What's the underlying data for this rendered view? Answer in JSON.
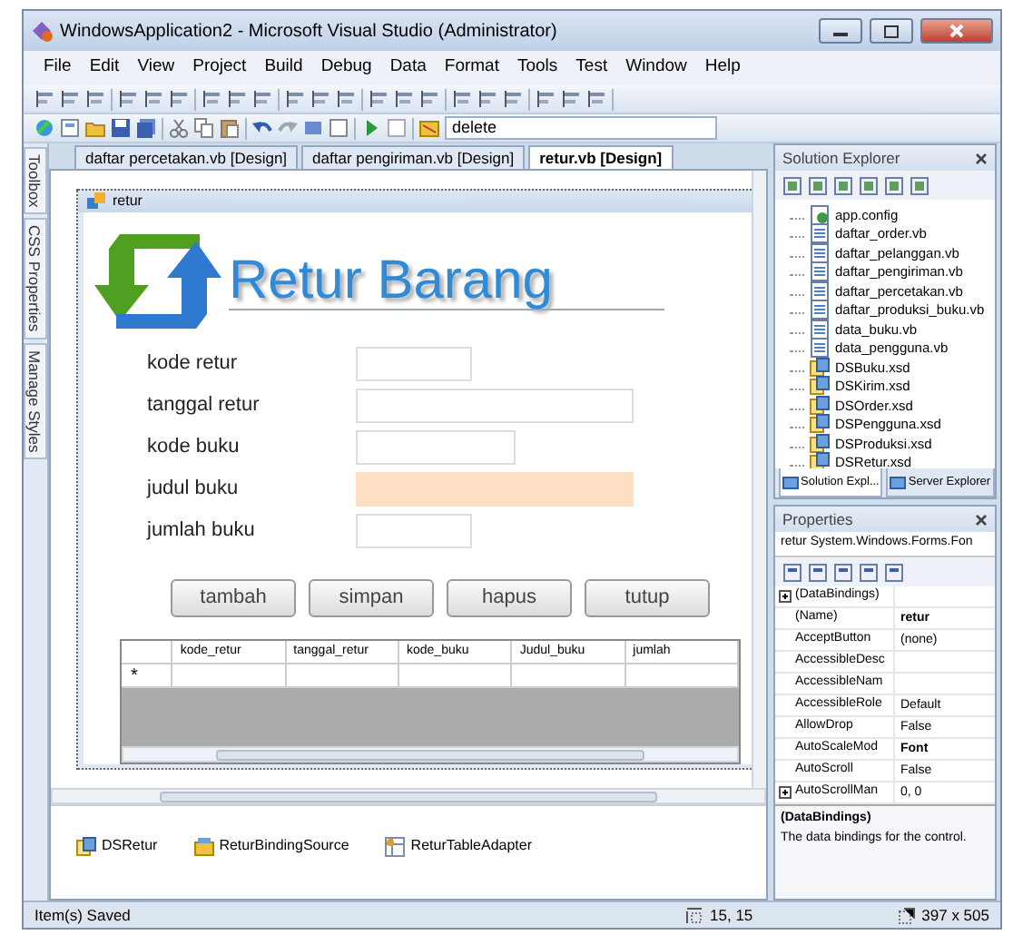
{
  "window": {
    "title": "WindowsApplication2 - Microsoft Visual Studio (Administrator)"
  },
  "menu": [
    "File",
    "Edit",
    "View",
    "Project",
    "Build",
    "Debug",
    "Data",
    "Format",
    "Tools",
    "Test",
    "Window",
    "Help"
  ],
  "toolbar": {
    "find_value": "delete"
  },
  "side_tabs": [
    "Toolbox",
    "CSS Properties",
    "Manage Styles"
  ],
  "doc_tabs": [
    {
      "label": "daftar percetakan.vb [Design]",
      "selected": false
    },
    {
      "label": "daftar pengiriman.vb [Design]",
      "selected": false
    },
    {
      "label": "retur.vb [Design]",
      "selected": true
    }
  ],
  "form": {
    "title": "retur",
    "heading": "Retur Barang",
    "fields": [
      {
        "label": "kode retur",
        "highlighted": false
      },
      {
        "label": "tanggal retur",
        "highlighted": false
      },
      {
        "label": "kode buku",
        "highlighted": false
      },
      {
        "label": "judul buku",
        "highlighted": true
      },
      {
        "label": "jumlah buku",
        "highlighted": false
      }
    ],
    "buttons": [
      "tambah",
      "simpan",
      "hapus",
      "tutup"
    ],
    "grid": {
      "columns": [
        "kode_retur",
        "tanggal_retur",
        "kode_buku",
        "Judul_buku",
        "jumlah"
      ],
      "new_row_marker": "*"
    }
  },
  "tray": [
    {
      "label": "DSRetur",
      "kind": "dataset"
    },
    {
      "label": "ReturBindingSource",
      "kind": "binding"
    },
    {
      "label": "ReturTableAdapter",
      "kind": "adapter"
    }
  ],
  "solution_explorer": {
    "title": "Solution Explorer",
    "items": [
      {
        "label": "app.config",
        "kind": "config"
      },
      {
        "label": "daftar_order.vb",
        "kind": "form"
      },
      {
        "label": "daftar_pelanggan.vb",
        "kind": "form"
      },
      {
        "label": "daftar_pengiriman.vb",
        "kind": "form"
      },
      {
        "label": "daftar_percetakan.vb",
        "kind": "form"
      },
      {
        "label": "daftar_produksi_buku.vb",
        "kind": "form"
      },
      {
        "label": "data_buku.vb",
        "kind": "form"
      },
      {
        "label": "data_pengguna.vb",
        "kind": "form"
      },
      {
        "label": "DSBuku.xsd",
        "kind": "dataset"
      },
      {
        "label": "DSKirim.xsd",
        "kind": "dataset"
      },
      {
        "label": "DSOrder.xsd",
        "kind": "dataset"
      },
      {
        "label": "DSPengguna.xsd",
        "kind": "dataset"
      },
      {
        "label": "DSProduksi.xsd",
        "kind": "dataset"
      },
      {
        "label": "DSRetur.xsd",
        "kind": "dataset"
      }
    ],
    "tabs": [
      {
        "label": "Solution Expl...",
        "selected": true
      },
      {
        "label": "Server Explorer",
        "selected": false
      }
    ]
  },
  "properties": {
    "title": "Properties",
    "object": "retur System.Windows.Forms.Fon",
    "rows": [
      {
        "name": "(DataBindings)",
        "value": "",
        "kind": "group",
        "bold": false
      },
      {
        "name": "(Name)",
        "value": "retur",
        "kind": "prop",
        "bold": true
      },
      {
        "name": "AcceptButton",
        "value": "(none)",
        "kind": "prop",
        "bold": false
      },
      {
        "name": "AccessibleDesc",
        "value": "",
        "kind": "prop",
        "bold": false
      },
      {
        "name": "AccessibleNam",
        "value": "",
        "kind": "prop",
        "bold": false
      },
      {
        "name": "AccessibleRole",
        "value": "Default",
        "kind": "prop",
        "bold": false
      },
      {
        "name": "AllowDrop",
        "value": "False",
        "kind": "prop",
        "bold": false
      },
      {
        "name": "AutoScaleMod",
        "value": "Font",
        "kind": "prop",
        "bold": true
      },
      {
        "name": "AutoScroll",
        "value": "False",
        "kind": "prop",
        "bold": false
      },
      {
        "name": "AutoScrollMan",
        "value": "0, 0",
        "kind": "group",
        "bold": false
      }
    ],
    "description_title": "(DataBindings)",
    "description": "The data bindings for the control."
  },
  "status_bar": {
    "text": "Item(s) Saved",
    "position": "15, 15",
    "size": "397 x 505"
  }
}
